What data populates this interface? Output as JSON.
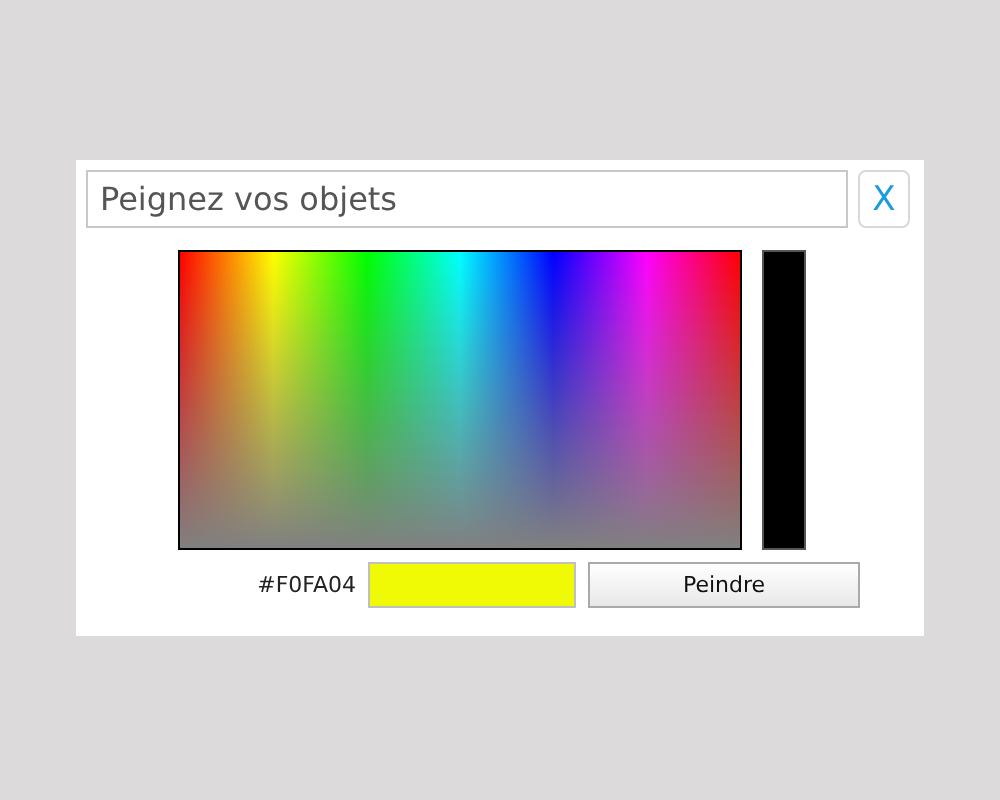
{
  "search": {
    "placeholder": "Peignez vos objets"
  },
  "close_button": {
    "label": "X"
  },
  "picker": {
    "hex": "#F0FA04",
    "swatch": {
      "color": "#f0fa04"
    }
  },
  "buttons": [
    {
      "label": "Peindre"
    }
  ]
}
